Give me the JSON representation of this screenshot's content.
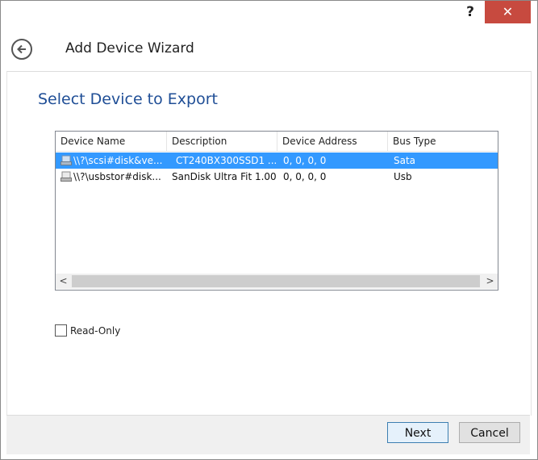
{
  "titlebar": {
    "help_label": "?",
    "close_label": "✕"
  },
  "wizard": {
    "title": "Add Device Wizard",
    "section_title": "Select Device to Export"
  },
  "list": {
    "columns": [
      "Device Name",
      "Description",
      "Device Address",
      "Bus Type"
    ],
    "rows": [
      {
        "name": "\\\\?\\scsi#disk&ve...",
        "description": "CT240BX300SSD1 ...",
        "address": "0, 0, 0, 0",
        "bus": "Sata",
        "selected": true
      },
      {
        "name": "\\\\?\\usbstor#disk...",
        "description": "SanDisk Ultra Fit 1.00",
        "address": "0, 0, 0, 0",
        "bus": "Usb",
        "selected": false
      }
    ],
    "scroll_left": "<",
    "scroll_right": ">"
  },
  "options": {
    "readonly_label": "Read-Only",
    "readonly_checked": false
  },
  "footer": {
    "next_label": "Next",
    "cancel_label": "Cancel"
  },
  "colors": {
    "accent": "#1f4e96",
    "selection": "#3399ff",
    "close": "#c74a3f"
  }
}
